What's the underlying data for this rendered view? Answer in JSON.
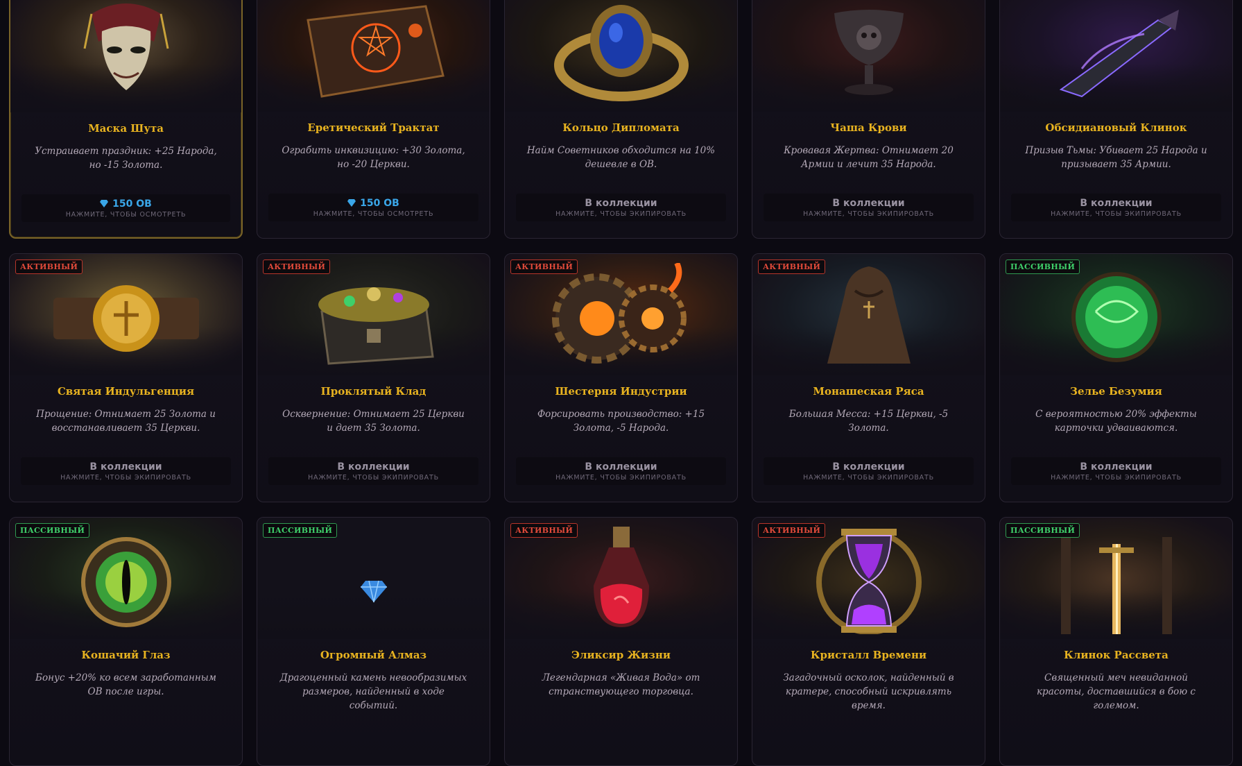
{
  "badges": {
    "active": "АКТИВНЫЙ",
    "passive": "ПАССИВНЫЙ"
  },
  "cards": [
    {
      "title": "Маска Шута",
      "desc": "Устраивает праздник: +25 Народа, но -15 Золота.",
      "status": "150 ОВ",
      "hint": "НАЖМИТЕ, ЧТОБЫ ОСМОТРЕТЬ",
      "art": "jester-mask",
      "selected": true
    },
    {
      "title": "Еретический Трактат",
      "desc": "Ограбить инквизицию: +30 Золота, но -20 Церкви.",
      "status": "150 ОВ",
      "hint": "НАЖМИТЕ, ЧТОБЫ ОСМОТРЕТЬ",
      "art": "heretic-book"
    },
    {
      "title": "Кольцо Дипломата",
      "desc": "Найм Советников обходится на 10% дешевле в ОВ.",
      "status": "В коллекции",
      "hint": "НАЖМИТЕ, ЧТОБЫ ЭКИПИРОВАТЬ",
      "art": "sapphire-ring"
    },
    {
      "title": "Чаша Крови",
      "desc": "Кровавая Жертва: Отнимает 20 Армии и лечит 35 Народа.",
      "status": "В коллекции",
      "hint": "НАЖМИТЕ, ЧТОБЫ ЭКИПИРОВАТЬ",
      "art": "blood-chalice"
    },
    {
      "title": "Обсидиановый Клинок",
      "desc": "Призыв Тьмы: Убивает 25 Народа и призывает 35 Армии.",
      "status": "В коллекции",
      "hint": "НАЖМИТЕ, ЧТОБЫ ЭКИПИРОВАТЬ",
      "art": "obsidian-blade"
    },
    {
      "badge": "АКТИВНЫЙ",
      "title": "Святая Индульгенция",
      "desc": "Прощение: Отнимает 25 Золота и восстанавливает 35 Церкви.",
      "status": "В коллекции",
      "hint": "НАЖМИТЕ, ЧТОБЫ ЭКИПИРОВАТЬ",
      "art": "holy-seal"
    },
    {
      "badge": "АКТИВНЫЙ",
      "title": "Проклятый Клад",
      "desc": "Осквернение: Отнимает 25 Церкви и дает 35 Золота.",
      "status": "В коллекции",
      "hint": "НАЖМИТЕ, ЧТОБЫ ЭКИПИРОВАТЬ",
      "art": "cursed-chest"
    },
    {
      "badge": "АКТИВНЫЙ",
      "title": "Шестерня Индустрии",
      "desc": "Форсировать производство: +15 Золота, -5 Народа.",
      "status": "В коллекции",
      "hint": "НАЖМИТЕ, ЧТОБЫ ЭКИПИРОВАТЬ",
      "art": "industry-gear"
    },
    {
      "badge": "АКТИВНЫЙ",
      "title": "Монашеская Ряса",
      "desc": "Большая Месса: +15 Церкви, -5 Золота.",
      "status": "В коллекции",
      "hint": "НАЖМИТЕ, ЧТОБЫ ЭКИПИРОВАТЬ",
      "art": "monk-robe"
    },
    {
      "badge": "ПАССИВНЫЙ",
      "title": "Зелье Безумия",
      "desc": "С вероятностью 20% эффекты карточки удваиваются.",
      "status": "В коллекции",
      "hint": "НАЖМИТЕ, ЧТОБЫ ЭКИПИРОВАТЬ",
      "art": "madness-potion"
    },
    {
      "badge": "ПАССИВНЫЙ",
      "title": "Кошачий Глаз",
      "desc": "Бонус +20% ко всем заработанным ОВ после игры.",
      "art": "cat-eye"
    },
    {
      "badge": "ПАССИВНЫЙ",
      "title": "Огромный Алмаз",
      "desc": "Драгоценный камень невообразимых размеров, найденный в ходе событий.",
      "art": "diamond"
    },
    {
      "badge": "АКТИВНЫЙ",
      "title": "Эликсир Жизни",
      "desc": "Легендарная «Живая Вода» от странствующего торговца.",
      "art": "life-elixir"
    },
    {
      "badge": "АКТИВНЫЙ",
      "title": "Кристалл Времени",
      "desc": "Загадочный осколок, найденный в кратере, способный искривлять время.",
      "art": "time-crystal"
    },
    {
      "badge": "ПАССИВНЫЙ",
      "title": "Клинок Рассвета",
      "desc": "Священный меч невиданной красоты, доставшийся в бою с големом.",
      "art": "dawn-blade"
    }
  ]
}
